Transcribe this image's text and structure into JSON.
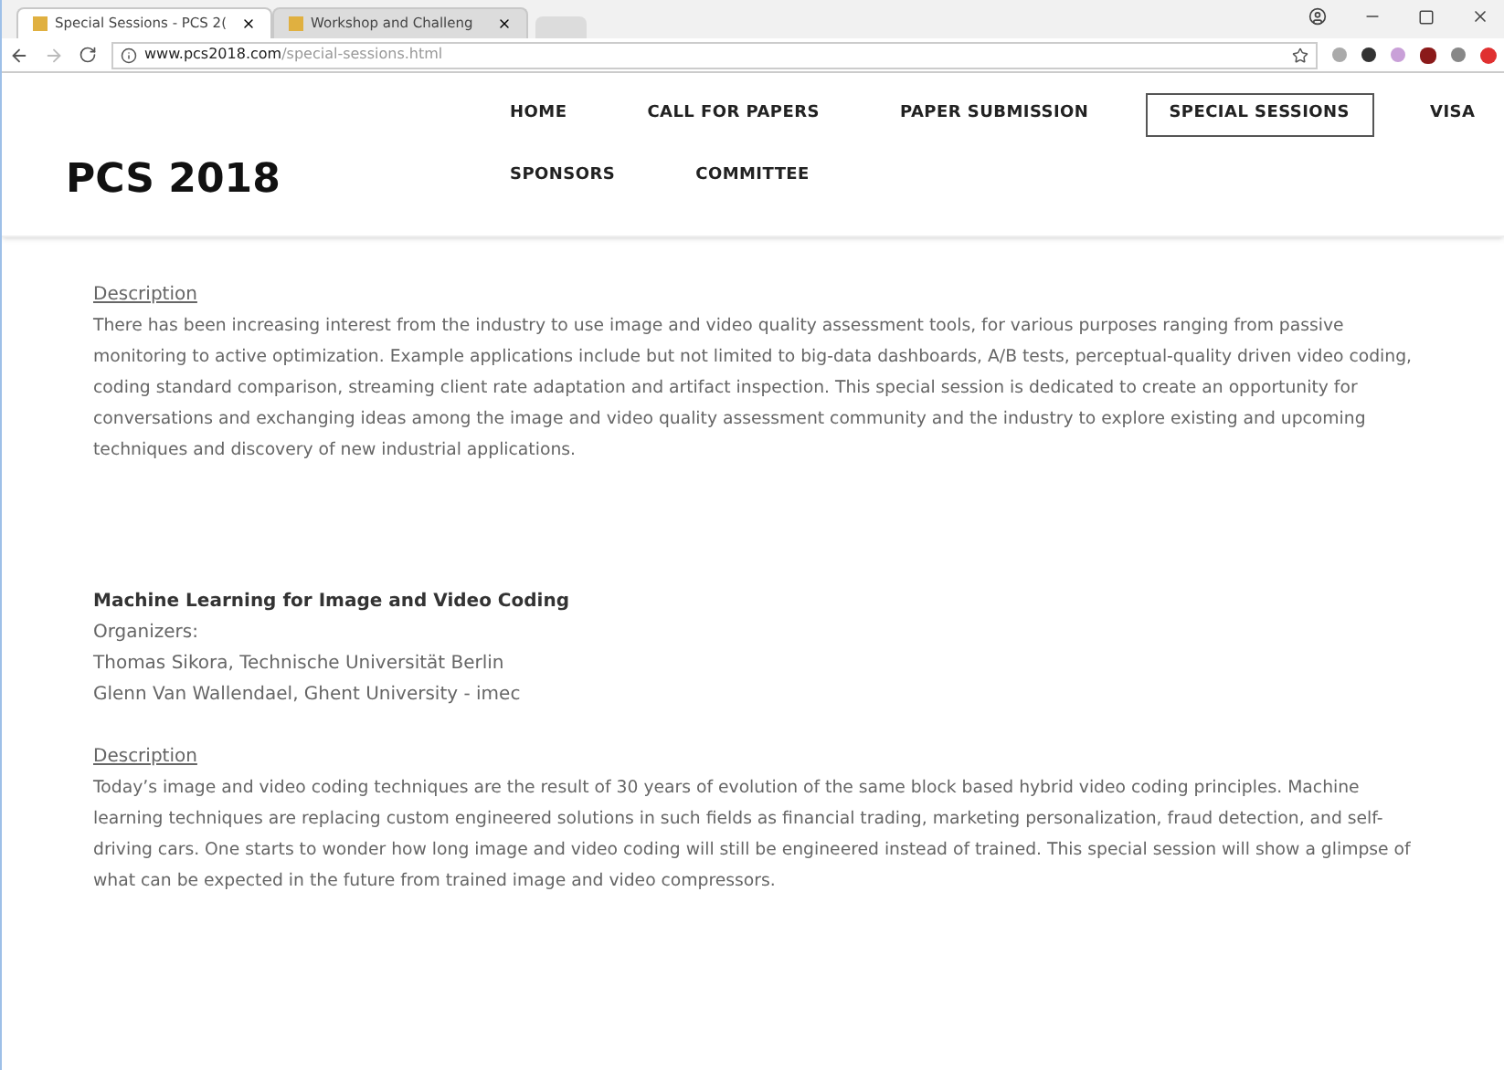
{
  "browser": {
    "tabs": [
      {
        "title": "Special Sessions - PCS 2(",
        "selected": true
      },
      {
        "title": "Workshop and Challeng",
        "selected": false
      }
    ],
    "url_host": "www.pcs2018.com",
    "url_path": "/special-sessions.html"
  },
  "site": {
    "logo": "PCS 2018",
    "nav": [
      {
        "label": "HOME",
        "selected": false
      },
      {
        "label": "CALL FOR PAPERS",
        "selected": false
      },
      {
        "label": "PAPER SUBMISSION",
        "selected": false
      },
      {
        "label": "SPECIAL SESSIONS",
        "selected": true
      },
      {
        "label": "VISA",
        "selected": false
      },
      {
        "label": "SPONSORS",
        "selected": false
      },
      {
        "label": "COMMITTEE",
        "selected": false
      }
    ]
  },
  "sessions": [
    {
      "description_heading": "Description",
      "description": "There has been increasing interest from the industry to use image and video quality assessment tools, for various purposes ranging from passive monitoring to active optimization. Example applications include but not limited to big-data dashboards, A/B tests, perceptual-quality driven video coding, coding standard comparison, streaming client rate adaptation and artifact inspection. This special session is dedicated to create an opportunity for conversations and exchanging ideas among the image and video quality assessment community and the industry to explore existing and upcoming techniques and discovery of new industrial applications."
    },
    {
      "title": "Machine Learning for Image and Video Coding",
      "organizers_label": "Organizers:",
      "organizers": [
        "Thomas Sikora, Technische Universität Berlin",
        "Glenn Van Wallendael, Ghent University - imec"
      ],
      "description_heading": "Description",
      "description": "Today’s image and video coding techniques are the result of 30 years of evolution of the same block based hybrid video coding principles. Machine learning techniques are replacing custom engineered solutions in such fields as financial trading, marketing personalization, fraud detection, and self-driving cars. One starts to wonder how long image and video coding will still be engineered instead of trained. This special session will show a glimpse of what can be expected in the future from trained image and video compressors."
    }
  ]
}
